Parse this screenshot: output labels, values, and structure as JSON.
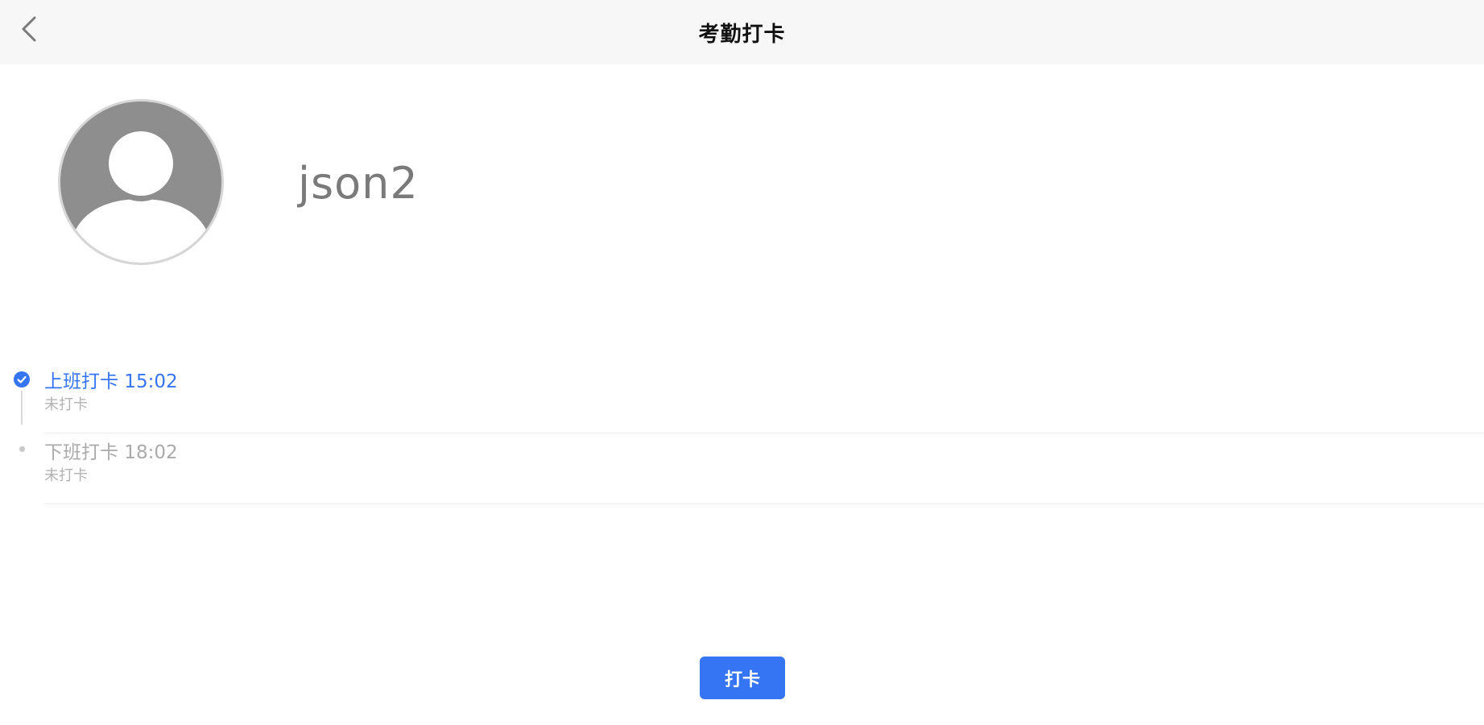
{
  "header": {
    "title": "考勤打卡",
    "back_icon": "chevron-left-icon"
  },
  "profile": {
    "avatar_icon": "user-avatar-icon",
    "name": "json2"
  },
  "records": [
    {
      "title": "上班打卡 15:02",
      "status": "未打卡",
      "state": "done",
      "icon": "check-circle-icon"
    },
    {
      "title": "下班打卡 18:02",
      "status": "未打卡",
      "state": "pending",
      "icon": "dot-icon"
    }
  ],
  "actions": {
    "punch_label": "打卡"
  },
  "colors": {
    "accent": "#3574f2",
    "header_bg": "#f7f7f7",
    "muted_text": "#aaaaaa",
    "avatar_gray": "#8e8e8e"
  }
}
